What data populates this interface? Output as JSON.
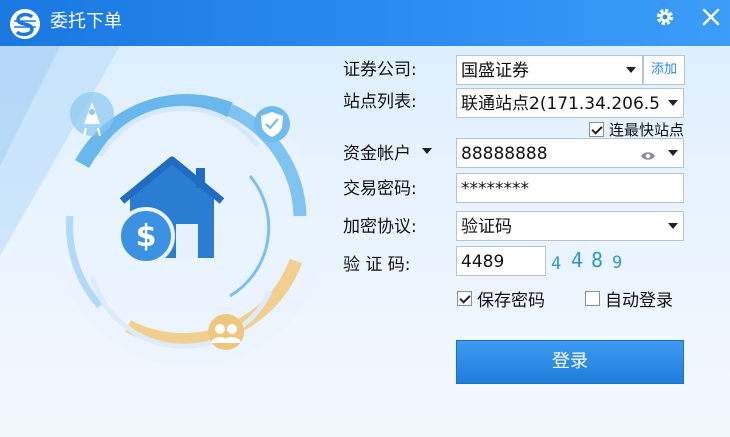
{
  "window": {
    "title": "委托下单",
    "accent": "#2a8cf2"
  },
  "titlebar": {
    "settings_icon": "gear-icon",
    "close_icon": "close-icon"
  },
  "form": {
    "broker_label": "证券公司:",
    "broker_value": "国盛证券",
    "add_label": "添加",
    "site_label": "站点列表:",
    "site_value": "联通站点2(171.34.206.5",
    "fastest_site_label": "连最快站点",
    "account_label": "资金帐户",
    "account_value": "88888888",
    "password_label": "交易密码:",
    "password_value": "********",
    "encryption_label": "加密协议:",
    "encryption_value": "验证码",
    "captcha_label": "验 证 码:",
    "captcha_value": "4489",
    "captcha_image_chars": [
      "4",
      "4",
      "8",
      "9"
    ],
    "save_password_label": "保存密码",
    "auto_login_label": "自动登录",
    "login_button": "登录"
  },
  "state": {
    "fastest_site_checked": true,
    "save_password_checked": true,
    "auto_login_checked": false
  }
}
